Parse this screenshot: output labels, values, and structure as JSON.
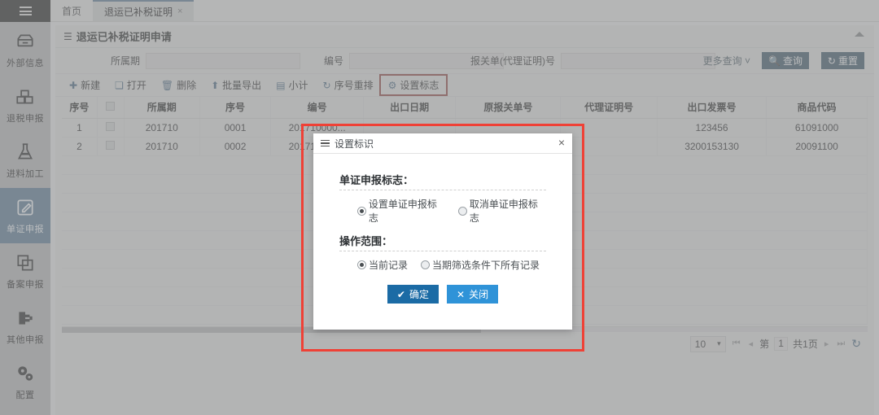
{
  "sidebar": {
    "menu_icon": "hamburger-icon",
    "items": [
      {
        "label": "外部信息",
        "icon": "server-icon",
        "active": false
      },
      {
        "label": "退税申报",
        "icon": "boxes-icon",
        "active": false
      },
      {
        "label": "进料加工",
        "icon": "flask-icon",
        "active": false
      },
      {
        "label": "单证申报",
        "icon": "edit-document-icon",
        "active": true
      },
      {
        "label": "备案申报",
        "icon": "copy-icon",
        "active": false
      },
      {
        "label": "其他申报",
        "icon": "plug-icon",
        "active": false
      },
      {
        "label": "配置",
        "icon": "gears-icon",
        "active": false
      }
    ]
  },
  "tabs": [
    {
      "label": "首页",
      "active": false,
      "closable": false
    },
    {
      "label": "退运已补税证明",
      "active": true,
      "closable": true,
      "close": "×"
    }
  ],
  "panel": {
    "title": "退运已补税证明申请",
    "list_icon": "list-icon",
    "collapse_icon": "chevron-up-icon"
  },
  "query_form": {
    "fields": [
      {
        "label": "所属期",
        "value": "",
        "placeholder": ""
      },
      {
        "label": "编号",
        "value": "",
        "placeholder": ""
      },
      {
        "label": "报关单(代理证明)号",
        "value": "",
        "placeholder": ""
      }
    ],
    "more_query": "更多查询 ˅",
    "search_button": "查询",
    "search_icon": "search-icon",
    "reset_button": "重置",
    "reset_icon": "undo-icon"
  },
  "toolbar": {
    "items": [
      {
        "label": "新建",
        "icon": "plus-icon",
        "glyph": "✚",
        "highlight": false
      },
      {
        "label": "打开",
        "icon": "open-folder-icon",
        "glyph": "❏",
        "highlight": false
      },
      {
        "label": "删除",
        "icon": "trash-icon",
        "glyph": "🗑",
        "highlight": false
      },
      {
        "label": "批量导出",
        "icon": "export-icon",
        "glyph": "⬆",
        "highlight": false
      },
      {
        "label": "小计",
        "icon": "subtotal-icon",
        "glyph": "▤",
        "highlight": false
      },
      {
        "label": "序号重排",
        "icon": "refresh-order-icon",
        "glyph": "↻",
        "highlight": false
      },
      {
        "label": "设置标志",
        "icon": "gear-icon",
        "glyph": "⚙",
        "highlight": true
      }
    ]
  },
  "table": {
    "columns": [
      "序号",
      "",
      "所属期",
      "序号",
      "编号",
      "出口日期",
      "原报关单号",
      "代理证明号",
      "出口发票号",
      "商品代码"
    ],
    "rows": [
      {
        "index": "1",
        "checkbox": false,
        "period": "201710",
        "seq": "0001",
        "number": "201710000...",
        "export_date": "",
        "orig_decl_no": "",
        "agent_cert_no": "",
        "export_invoice_no": "123456",
        "commodity_code": "61091000"
      },
      {
        "index": "2",
        "checkbox": false,
        "period": "201710",
        "seq": "0002",
        "number": "201710000...",
        "export_date": "",
        "orig_decl_no": "",
        "agent_cert_no": "",
        "export_invoice_no": "3200153130",
        "commodity_code": "20091100"
      }
    ],
    "empty_row_count": 9
  },
  "pagination": {
    "page_size": "10",
    "page_size_carat": "▾",
    "first_icon": "⏮",
    "prev_icon": "◂",
    "page_label": "第",
    "page_number": "1",
    "total_label": "共1页",
    "next_icon": "▸",
    "last_icon": "⏭",
    "refresh_icon": "↻"
  },
  "modal": {
    "title": "设置标识",
    "menu_icon": "hamburger-icon",
    "close_icon": "×",
    "sections": [
      {
        "title": "单证申报标志：",
        "options": [
          {
            "label": "设置单证申报标志",
            "selected": true
          },
          {
            "label": "取消单证申报标志",
            "selected": false
          }
        ]
      },
      {
        "title": "操作范围：",
        "options": [
          {
            "label": "当前记录",
            "selected": true
          },
          {
            "label": "当期筛选条件下所有记录",
            "selected": false
          }
        ]
      }
    ],
    "ok_button": "确定",
    "ok_icon": "✔",
    "close_button": "关闭",
    "close_button_icon": "✕"
  },
  "colors": {
    "accent_blue": "#3d8fd0",
    "button_blue": "#2f6f9f",
    "modal_ok": "#1b6ba5",
    "modal_close": "#2f93d8",
    "annotation_red": "#ef4136",
    "sidebar_bg": "#b9bcbe"
  }
}
